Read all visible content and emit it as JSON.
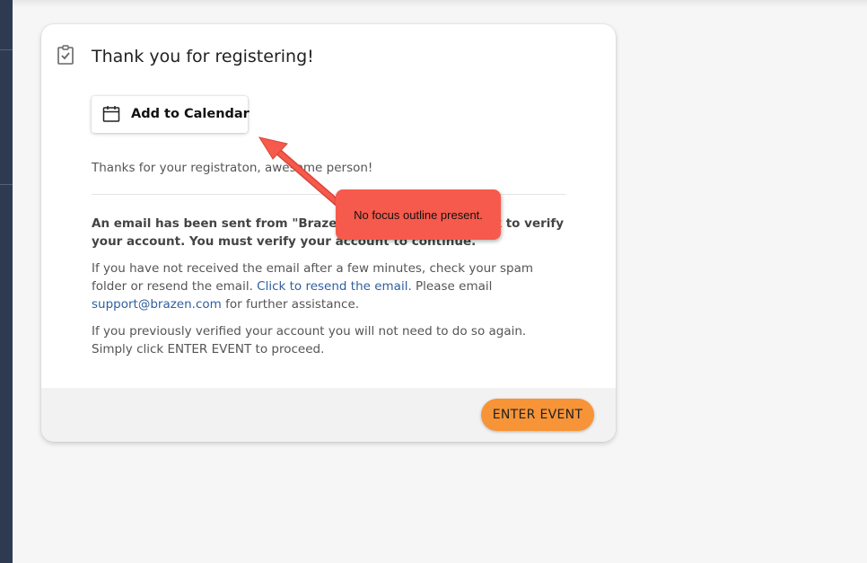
{
  "card": {
    "title": "Thank you for registering!",
    "calendar_button_label": "Add to Calendar",
    "thanks_text": "Thanks for your registraton, awesome person!",
    "email_notice": "An email has been sent from \"Brazen\" to confirm with a link to verify your account. You must verify your account to continue.",
    "resend_text_before": "If you have not received the email after a few minutes, check your spam folder or resend the email. ",
    "resend_link": "Click to resend the email.",
    "resend_text_after": " Please email ",
    "support_email": "support@brazen.com",
    "resend_text_end": " for further assistance.",
    "verified_text": "If you previously verified your account you will not need to do so again. Simply click ENTER EVENT to proceed.",
    "enter_button_label": "ENTER EVENT"
  },
  "annotation": {
    "callout_text": "No focus outline present."
  },
  "colors": {
    "accent": "#f79437",
    "link": "#2f5f9e",
    "callout": "#f65a4c",
    "sidebar": "#2d3a52"
  },
  "icons": {
    "header": "clipboard-check-icon",
    "calendar": "calendar-icon"
  }
}
